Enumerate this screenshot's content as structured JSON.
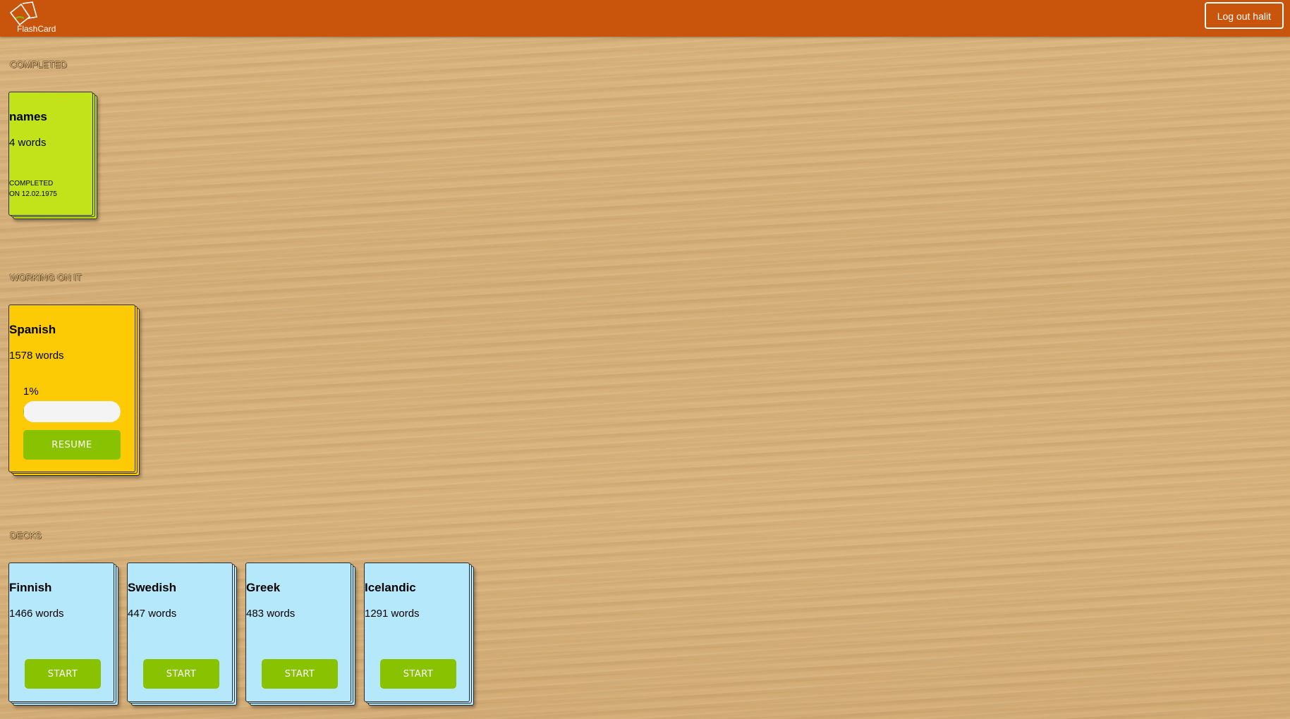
{
  "header": {
    "logo_text": "FlashCard",
    "logout_label": "Log out halit"
  },
  "sections": {
    "completed": "COMPLETED",
    "working": "WORKING ON IT",
    "decks": "DECKS"
  },
  "completed_decks": [
    {
      "name": "names",
      "words": "4 words",
      "status_line1": "COMPLETED",
      "status_line2": "ON 12.02.1975"
    }
  ],
  "in_progress_decks": [
    {
      "name": "Spanish",
      "words": "1578 words",
      "progress_text": "1%",
      "progress_fraction": 0.01,
      "button_label": "RESUME"
    }
  ],
  "decks": [
    {
      "name": "Finnish",
      "words": "1466 words",
      "button_label": "START"
    },
    {
      "name": "Swedish",
      "words": "447 words",
      "button_label": "START"
    },
    {
      "name": "Greek",
      "words": "483 words",
      "button_label": "START"
    },
    {
      "name": "Icelandic",
      "words": "1291 words",
      "button_label": "START"
    }
  ],
  "colors": {
    "header": "#c9550c",
    "completed_card": "#c2e21a",
    "in_progress_card": "#fccb05",
    "deck_card": "#b5e8fb",
    "button": "#88c200"
  },
  "icons": {
    "logo": "flashcard-logo-icon"
  }
}
